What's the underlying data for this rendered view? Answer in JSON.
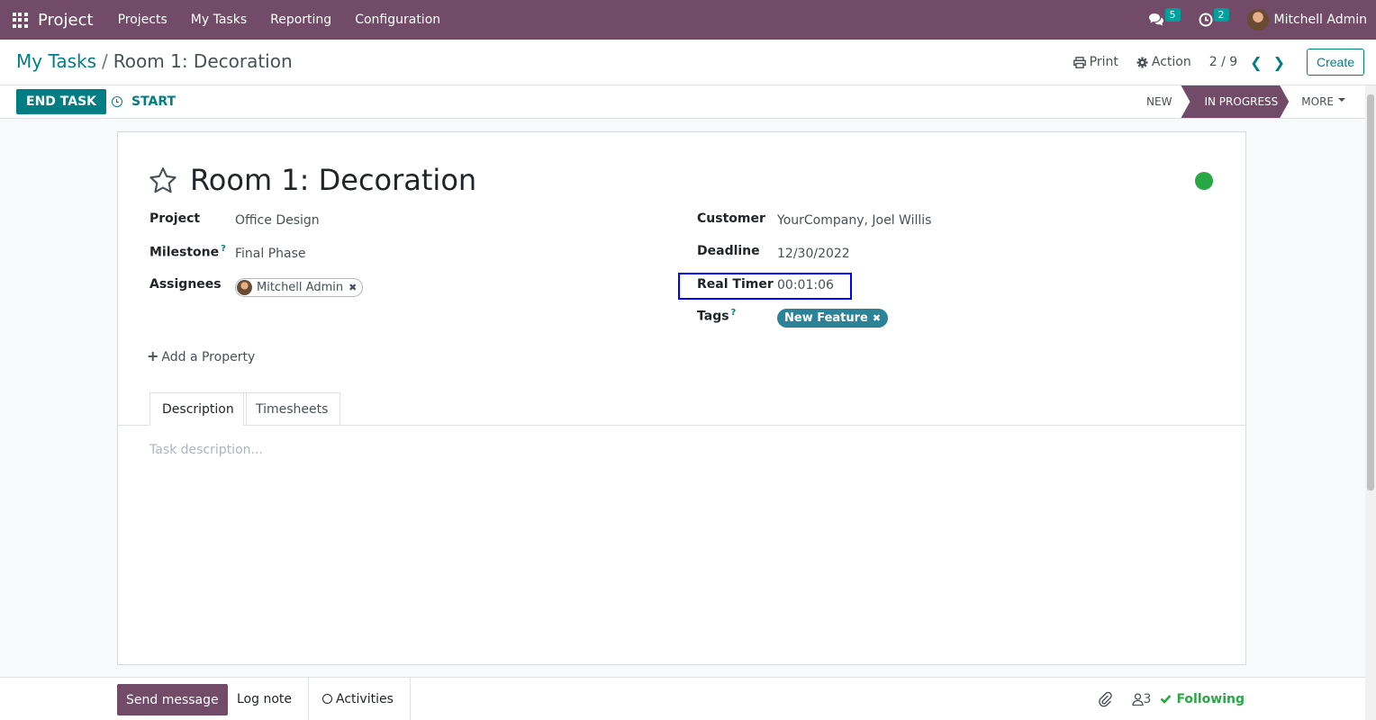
{
  "navbar": {
    "app_name": "Project",
    "menu": [
      "Projects",
      "My Tasks",
      "Reporting",
      "Configuration"
    ],
    "messages_count": "5",
    "activities_count": "2",
    "user_name": "Mitchell Admin"
  },
  "control_panel": {
    "breadcrumb_parent": "My Tasks",
    "breadcrumb_separator": "/",
    "breadcrumb_current": "Room 1: Decoration",
    "print_label": "Print",
    "action_label": "Action",
    "pager": "2 / 9",
    "create_label": "Create"
  },
  "statusbar": {
    "end_task_label": "END TASK",
    "start_label": "START",
    "stages": [
      "NEW",
      "IN PROGRESS",
      "MORE"
    ],
    "active_stage": "IN PROGRESS"
  },
  "task": {
    "title": "Room 1: Decoration",
    "kanban_state_color": "#28a745",
    "fields": {
      "project_label": "Project",
      "project_value": "Office Design",
      "milestone_label": "Milestone",
      "milestone_help": "?",
      "milestone_value": "Final Phase",
      "assignees_label": "Assignees",
      "assignee": "Mitchell Admin",
      "customer_label": "Customer",
      "customer_value": "YourCompany, Joel Willis",
      "deadline_label": "Deadline",
      "deadline_value": "12/30/2022",
      "real_timer_label": "Real Timer",
      "real_timer_value": "00:01:06",
      "tags_label": "Tags",
      "tags_help": "?",
      "tag": "New Feature"
    },
    "add_property_label": "Add a Property",
    "tabs": [
      "Description",
      "Timesheets"
    ],
    "description_placeholder": "Task description..."
  },
  "chatter": {
    "send_message_label": "Send message",
    "log_note_label": "Log note",
    "activities_label": "Activities",
    "followers_count": "3",
    "following_label": "Following"
  },
  "colors": {
    "brand": "#714b67",
    "accent": "#017e84",
    "tag": "#2c8397",
    "following": "#28a745",
    "highlight": "#0000ff"
  }
}
